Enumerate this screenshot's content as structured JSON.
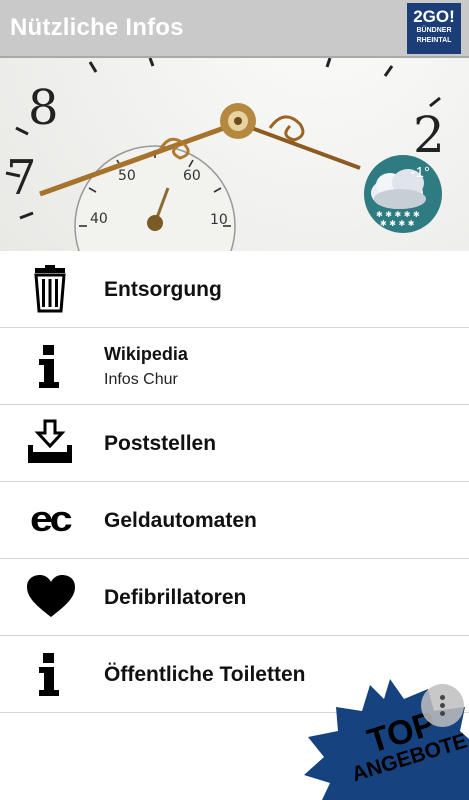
{
  "header": {
    "title": "Nützliche Infos",
    "logo_main": "2GO!",
    "logo_sub_1": "BÜNDNER",
    "logo_sub_2": "RHEINTAL"
  },
  "hero": {
    "weather": {
      "temperature": "-1°",
      "icon": "snow-cloud-icon"
    }
  },
  "list": {
    "items": [
      {
        "title": "Entsorgung",
        "icon": "trash-icon"
      },
      {
        "title": "Wikipedia",
        "subtitle": "Infos Chur",
        "icon": "info-icon"
      },
      {
        "title": "Poststellen",
        "icon": "inbox-download-icon"
      },
      {
        "title": "Geldautomaten",
        "icon": "ec-card-icon",
        "icon_text": "ec"
      },
      {
        "title": "Defibrillatoren",
        "icon": "heart-icon"
      },
      {
        "title": "Öffentliche Toiletten",
        "icon": "info-icon"
      }
    ]
  },
  "badge": {
    "line1": "TOP",
    "line2": "ANGEBOTE"
  },
  "colors": {
    "header_bg": "#c9c9c9",
    "logo_bg": "#1b3d78",
    "weather_bg": "#2f7b82",
    "badge_bg": "#16427f"
  }
}
